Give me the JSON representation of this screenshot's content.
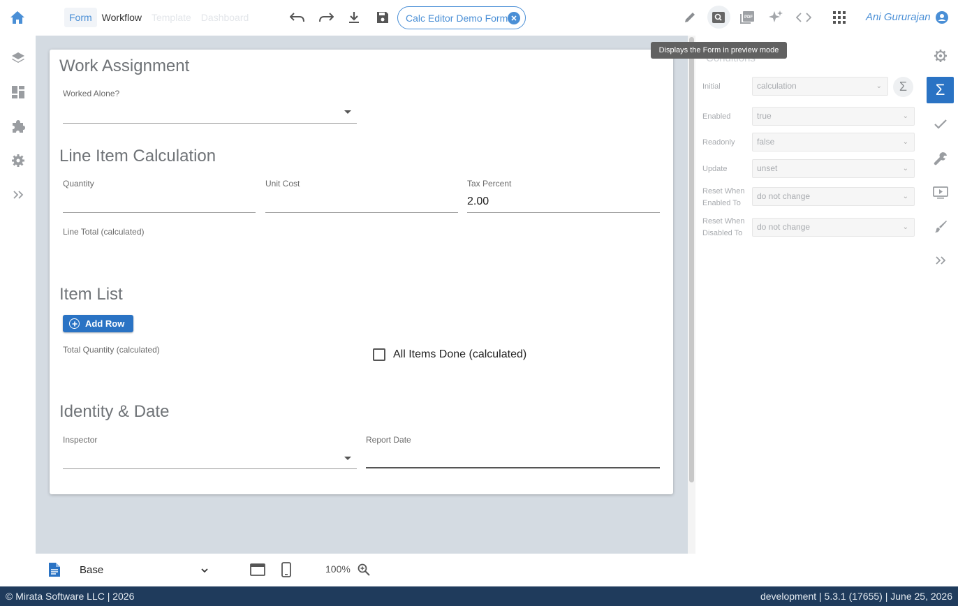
{
  "header": {
    "tabs": [
      {
        "label": "Form"
      },
      {
        "label": "Workflow"
      },
      {
        "label": "Template"
      },
      {
        "label": "Dashboard"
      }
    ],
    "form_name": "Calc Editor Demo Form",
    "user_name": "Ani Gururajan",
    "tooltip": "Displays the Form in preview mode"
  },
  "form": {
    "sections": {
      "work_assignment": "Work Assignment",
      "line_item": "Line Item Calculation",
      "item_list": "Item List",
      "identity": "Identity & Date"
    },
    "fields": {
      "worked_alone": "Worked Alone?",
      "quantity": "Quantity",
      "unit_cost": "Unit Cost",
      "tax_percent": "Tax Percent",
      "tax_percent_value": "2.00",
      "line_total": "Line Total (calculated)",
      "total_quantity": "Total Quantity (calculated)",
      "all_items_done": "All Items Done (calculated)",
      "inspector": "Inspector",
      "report_date": "Report Date"
    },
    "add_row_label": "Add Row"
  },
  "canvas_bottom": {
    "layer_select": "Base",
    "zoom": "100%"
  },
  "properties": {
    "heading": "Conditions",
    "rows": [
      {
        "label": "Initial",
        "value": "calculation"
      },
      {
        "label": "Enabled",
        "value": "true"
      },
      {
        "label": "Readonly",
        "value": "false"
      },
      {
        "label": "Update",
        "value": "unset"
      },
      {
        "label": "Reset When Enabled To",
        "value": "do not change"
      },
      {
        "label": "Reset When Disabled To",
        "value": "do not change"
      }
    ],
    "sigma_symbol": "Σ"
  },
  "footer": {
    "left": "© Mirata Software LLC | 2026",
    "right": "development | 5.3.1 (17655) | June 25, 2026"
  },
  "colors": {
    "accent": "#2a73c4",
    "link": "#4a8fd6",
    "footer_bg": "#1f3b5c",
    "canvas_bg": "#d4dbe2"
  }
}
